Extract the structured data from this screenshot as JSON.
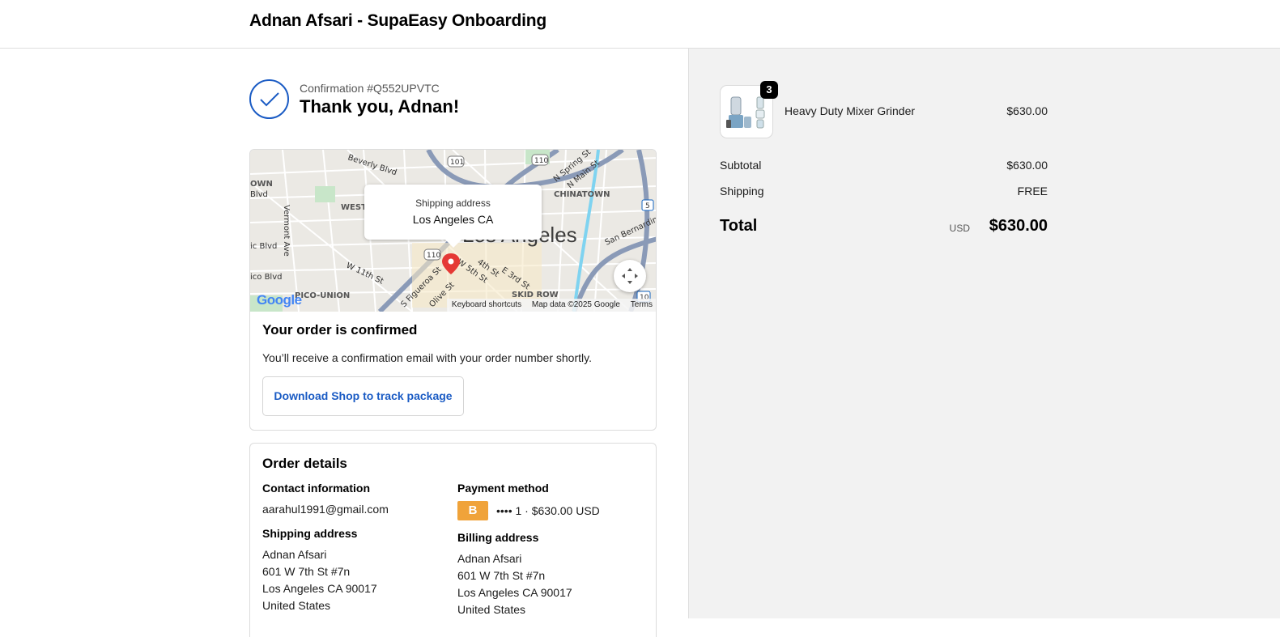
{
  "header": {
    "title": "Adnan Afsari - SupaEasy Onboarding"
  },
  "confirmation": {
    "number_label": "Confirmation #Q552UPVTC",
    "thanks": "Thank you, Adnan!"
  },
  "map": {
    "popup_label": "Shipping address",
    "popup_value": "Los Angeles CA",
    "city": "Los Angeles",
    "google": "Google",
    "footer": {
      "shortcuts": "Keyboard shortcuts",
      "data": "Map data ©2025 Google",
      "terms": "Terms"
    },
    "streets": [
      "Beverly Blvd",
      "Vermont Ave",
      "W 11th St",
      "Pico Blvd",
      "S Figueroa St",
      "4th St",
      "E 3rd St",
      "SKID ROW",
      "PICO-UNION",
      "N Spring St",
      "N Main St",
      "San Bernardino",
      "CHINATOWN",
      "WEST",
      "W 5th St",
      "Olive St",
      "OWN",
      "Blvd",
      "ic Blvd",
      "ico Blvd",
      "101",
      "110",
      "110",
      "10",
      "5"
    ],
    "colors": {
      "road": "#8a9ab7",
      "pin": "#e53935",
      "park": "#c8e6c9"
    }
  },
  "order_confirmed": {
    "title": "Your order is confirmed",
    "description": "You’ll receive a confirmation email with your order number shortly.",
    "download_button": "Download Shop to track package"
  },
  "order_details": {
    "title": "Order details",
    "contact": {
      "label": "Contact information",
      "email": "aarahul1991@gmail.com"
    },
    "payment": {
      "label": "Payment method",
      "badge": "B",
      "text": "•••• 1 · $630.00 USD"
    },
    "shipping": {
      "label": "Shipping address",
      "lines": [
        "Adnan Afsari",
        "601 W 7th St #7n",
        "Los Angeles CA 90017",
        "United States"
      ]
    },
    "billing": {
      "label": "Billing address",
      "lines": [
        "Adnan Afsari",
        "601 W 7th St #7n",
        "Los Angeles CA 90017",
        "United States"
      ]
    }
  },
  "summary": {
    "product": {
      "name": "Heavy Duty Mixer Grinder",
      "price": "$630.00",
      "quantity": "3"
    },
    "subtotal_label": "Subtotal",
    "subtotal_value": "$630.00",
    "shipping_label": "Shipping",
    "shipping_value": "FREE",
    "total_label": "Total",
    "total_currency": "USD",
    "total_value": "$630.00"
  },
  "colors": {
    "accent": "#1a5bc4",
    "sidebar_bg": "#f2f2f2",
    "badge": "#f0a33a"
  }
}
